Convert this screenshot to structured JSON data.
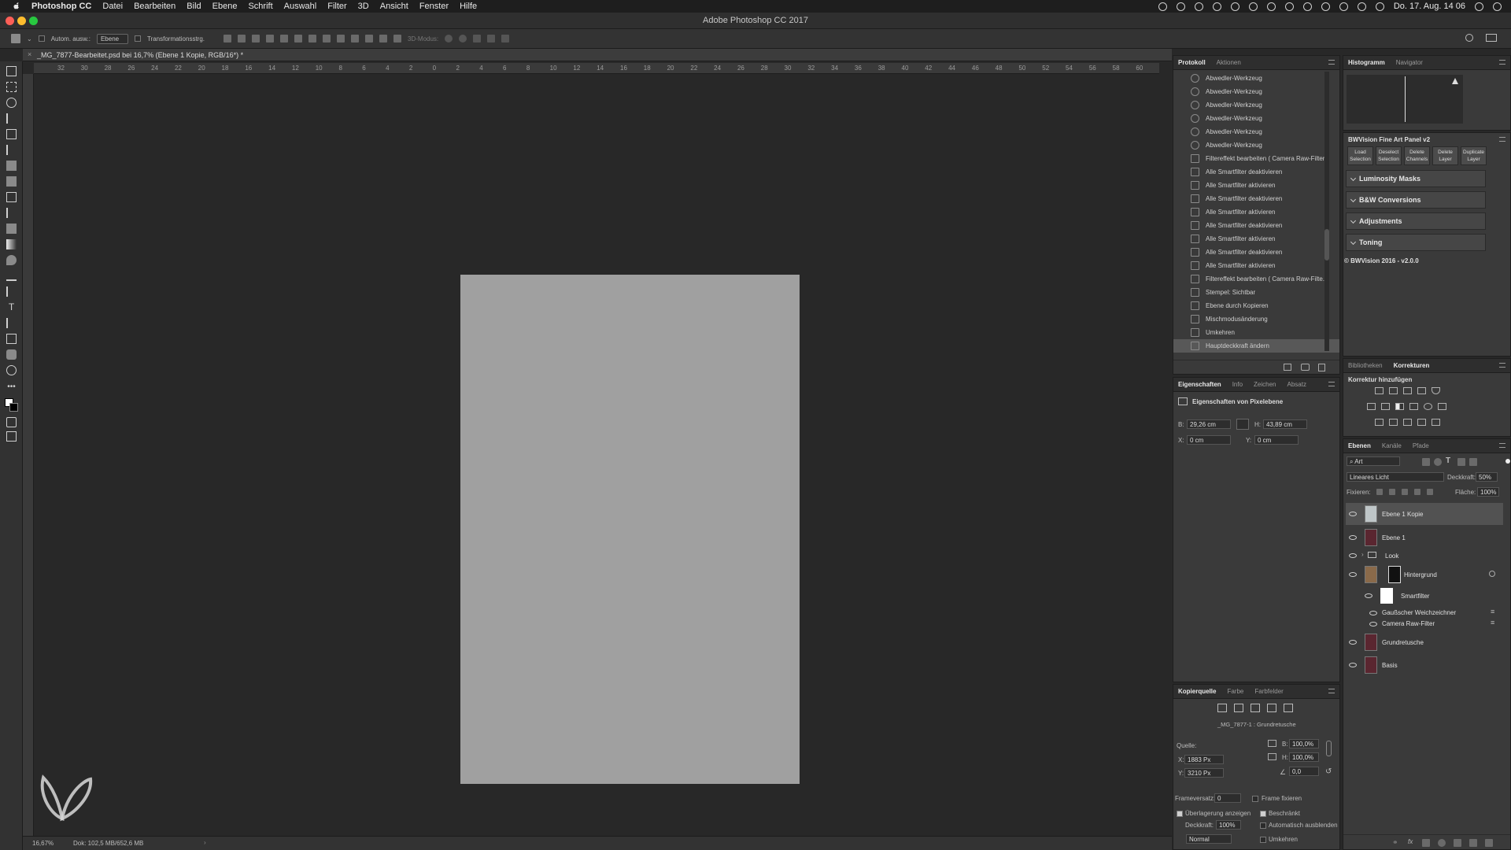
{
  "menubar": {
    "app": "Photoshop CC",
    "items": [
      "Datei",
      "Bearbeiten",
      "Bild",
      "Ebene",
      "Schrift",
      "Auswahl",
      "Filter",
      "3D",
      "Ansicht",
      "Fenster",
      "Hilfe"
    ],
    "clock": "Do. 17. Aug. 14 06"
  },
  "window": {
    "title": "Adobe Photoshop CC 2017"
  },
  "options": {
    "auto_select": "Autom. ausw.:",
    "layer_select": "Ebene",
    "transform": "Transformationsstrg.",
    "mode3d": "3D-Modus:"
  },
  "document": {
    "tab": "_MG_7877-Bearbeitet.psd bei 16,7% (Ebene 1 Kopie, RGB/16*) *",
    "ruler_ticks": [
      "32",
      "30",
      "28",
      "26",
      "24",
      "22",
      "20",
      "18",
      "16",
      "14",
      "12",
      "10",
      "8",
      "6",
      "4",
      "2",
      "0",
      "2",
      "4",
      "6",
      "8",
      "10",
      "12",
      "14",
      "16",
      "18",
      "20",
      "22",
      "24",
      "26",
      "28",
      "30",
      "32",
      "34",
      "36",
      "38",
      "40",
      "42",
      "44",
      "46",
      "48",
      "50",
      "52",
      "54",
      "56",
      "58",
      "60",
      "62"
    ],
    "zoom": "16,67%",
    "doc_size": "Dok: 102,5 MB/652,6 MB"
  },
  "history": {
    "tabs": [
      "Protokoll",
      "Aktionen"
    ],
    "items": [
      "Abwedler-Werkzeug",
      "Abwedler-Werkzeug",
      "Abwedler-Werkzeug",
      "Abwedler-Werkzeug",
      "Abwedler-Werkzeug",
      "Abwedler-Werkzeug",
      "Filtereffekt bearbeiten ( Camera Raw-Filter )",
      "Alle Smartfilter deaktivieren",
      "Alle Smartfilter aktivieren",
      "Alle Smartfilter deaktivieren",
      "Alle Smartfilter aktivieren",
      "Alle Smartfilter deaktivieren",
      "Alle Smartfilter aktivieren",
      "Alle Smartfilter deaktivieren",
      "Alle Smartfilter aktivieren",
      "Filtereffekt bearbeiten ( Camera Raw-Filte...",
      "Stempel: Sichtbar",
      "Ebene durch Kopieren",
      "Mischmodusänderung",
      "Umkehren",
      "Hauptdeckkraft ändern"
    ]
  },
  "properties": {
    "tabs": [
      "Eigenschaften",
      "Info",
      "Zeichen",
      "Absatz"
    ],
    "heading": "Eigenschaften von Pixelebene",
    "b_label": "B:",
    "b_value": "29,26 cm",
    "h_label": "H:",
    "h_value": "43,89 cm",
    "x_label": "X:",
    "x_value": "0 cm",
    "y_label": "Y:",
    "y_value": "0 cm"
  },
  "clone_source": {
    "tabs": [
      "Kopierquelle",
      "Farbe",
      "Farbfelder"
    ],
    "source_name": "_MG_7877-1 : Grundretusche",
    "quelle": "Quelle:",
    "x_label": "X:",
    "x_value": "1883 Px",
    "y_label": "Y:",
    "y_value": "3210 Px",
    "w_label": "B:",
    "w_value": "100,0%",
    "h_label": "H:",
    "h_value": "100,0%",
    "angle": "0,0",
    "frame_offset_label": "Frameversatz:",
    "frame_offset": "0",
    "lock_frame": "Frame fixieren",
    "show_overlay": "Überlagerung anzeigen",
    "clipped": "Beschränkt",
    "opacity_label": "Deckkraft:",
    "opacity": "100%",
    "auto_hide": "Automatisch ausblenden",
    "invert": "Umkehren",
    "mode": "Normal"
  },
  "histogram": {
    "tabs": [
      "Histogramm",
      "Navigator"
    ]
  },
  "bwvision": {
    "title": "BWVision Fine Art Panel v2",
    "buttons": [
      [
        "Load",
        "Selection"
      ],
      [
        "Deselect",
        "Selection"
      ],
      [
        "Delete",
        "Channels"
      ],
      [
        "Delete",
        "Layer"
      ],
      [
        "Duplicate",
        "Layer"
      ]
    ],
    "sections": [
      "Luminosity Masks",
      "B&W Conversions",
      "Adjustments",
      "Toning"
    ],
    "footer": "© BWVision 2016 - v2.0.0"
  },
  "adjustments": {
    "tabs": [
      "Bibliotheken",
      "Korrekturen"
    ],
    "heading": "Korrektur hinzufügen"
  },
  "layers": {
    "tabs": [
      "Ebenen",
      "Kanäle",
      "Pfade"
    ],
    "filter": "Art",
    "blend_mode": "Lineares Licht",
    "opacity_label": "Deckkraft:",
    "opacity": "50%",
    "lock_label": "Fixieren:",
    "fill_label": "Fläche:",
    "fill": "100%",
    "items": [
      {
        "name": "Ebene 1 Kopie"
      },
      {
        "name": "Ebene 1"
      },
      {
        "name": "Look"
      },
      {
        "name": "Hintergrund"
      },
      {
        "name": "Smartfilter"
      },
      {
        "name": "Gaußscher Weichzeichner"
      },
      {
        "name": "Camera Raw-Filter"
      },
      {
        "name": "Grundretusche"
      },
      {
        "name": "Basis"
      }
    ]
  },
  "colors": {
    "accent": "#585858",
    "doc_fill": "#a0a0a0"
  }
}
